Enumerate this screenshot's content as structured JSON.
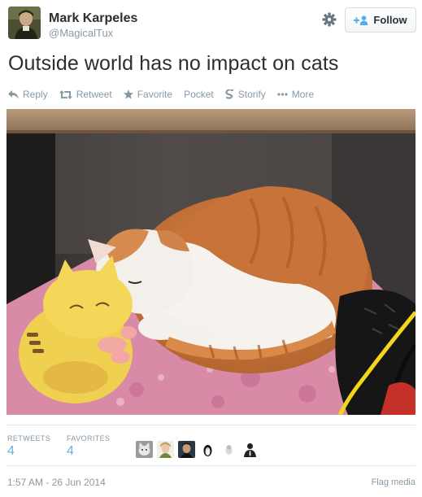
{
  "user": {
    "name": "Mark Karpeles",
    "handle": "@MagicalTux"
  },
  "follow_button": {
    "label": "Follow",
    "icon": "add-user-icon"
  },
  "tweet": {
    "text": "Outside world has no impact on cats"
  },
  "actions": [
    {
      "label": "Reply",
      "icon": "reply-icon"
    },
    {
      "label": "Retweet",
      "icon": "retweet-icon"
    },
    {
      "label": "Favorite",
      "icon": "star-icon"
    },
    {
      "label": "Pocket",
      "icon": ""
    },
    {
      "label": "Storify",
      "icon": "storify-icon"
    },
    {
      "label": "More",
      "icon": "more-dots-icon"
    }
  ],
  "stats": {
    "retweets_label": "RETWEETS",
    "retweets": "4",
    "favorites_label": "FAVORITES",
    "favorites": "4"
  },
  "favoriters": [
    "cat-avatar",
    "woman-avatar",
    "man-avatar",
    "penguin-avatar",
    "egg-avatar",
    "silhouette-avatar"
  ],
  "timestamp": "1:57 AM - 26 Jun 2014",
  "flag_media": "Flag media",
  "colors": {
    "link_blue": "#66b5d2",
    "muted": "#8899a6",
    "text": "#292f33",
    "follow_blue": "#55acee"
  }
}
